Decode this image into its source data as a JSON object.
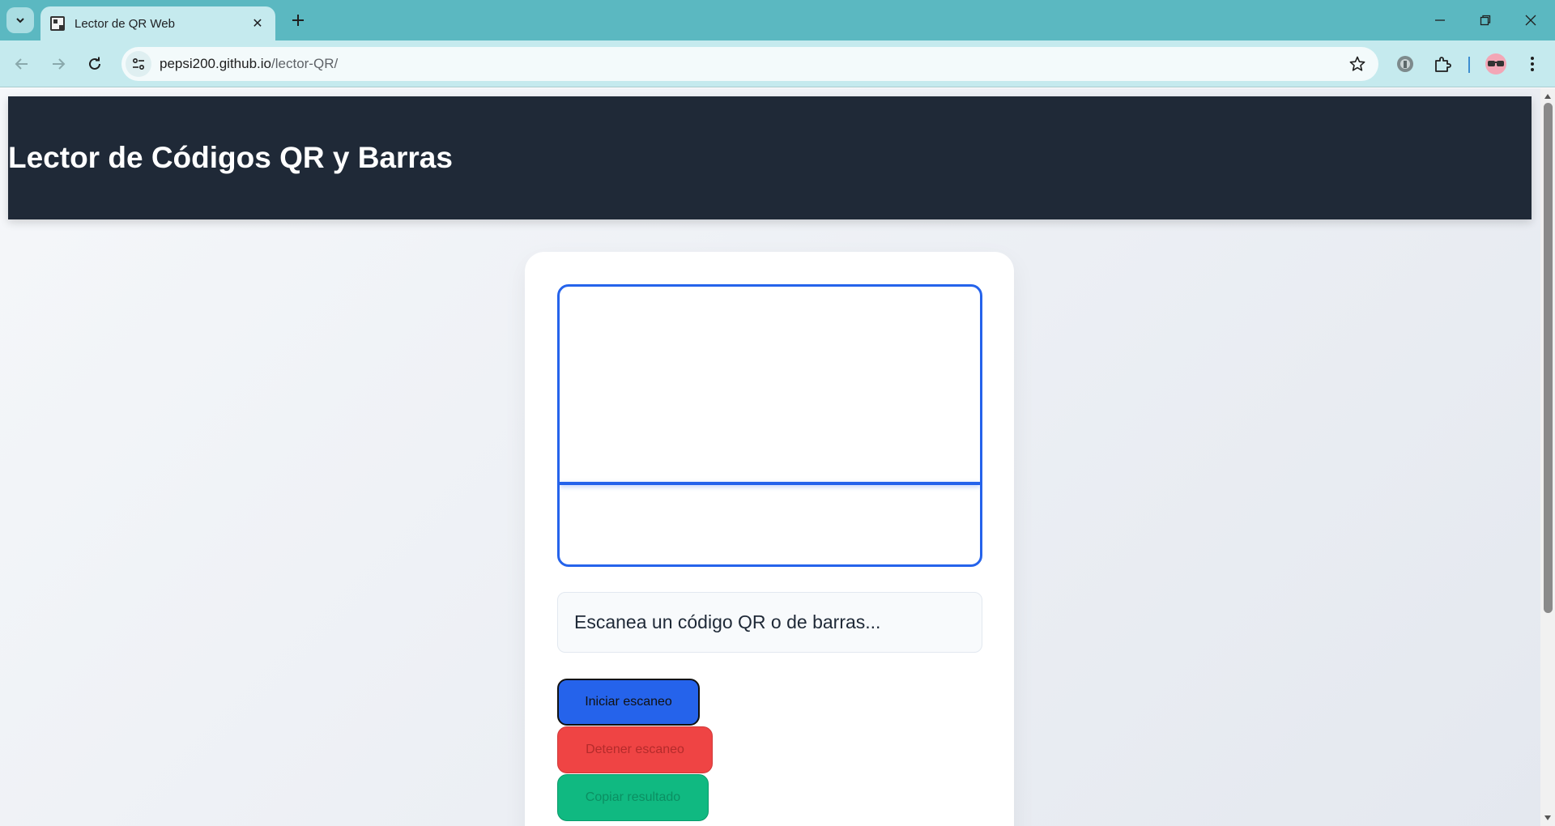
{
  "browser": {
    "tab": {
      "title": "Lector de QR Web",
      "favicon": "qr-code-favicon-icon"
    },
    "address_bar": {
      "domain": "pepsi200.github.io",
      "path": "/lector-QR/"
    },
    "icons": {
      "tab_search": "chevron-down-icon",
      "tab_close": "close-icon",
      "new_tab": "plus-icon",
      "back": "arrow-left-icon",
      "forward": "arrow-right-icon",
      "reload": "reload-icon",
      "site_info": "tune-icon",
      "bookmark": "star-icon",
      "extensions": "puzzle-icon",
      "menu": "kebab-menu-icon"
    },
    "colors": {
      "frame": "#5bb8c1",
      "toolbar": "#c5eaee"
    }
  },
  "page": {
    "header": {
      "title": "Lector de Códigos QR y Barras"
    },
    "result": {
      "text": "Escanea un código QR o de barras..."
    },
    "buttons": {
      "start": "Iniciar escaneo",
      "stop": "Detener escaneo",
      "copy": "Copiar resultado"
    },
    "colors": {
      "header_bg": "#1f2937",
      "accent": "#2563eb",
      "stop": "#ef4444",
      "copy": "#10b981"
    }
  }
}
